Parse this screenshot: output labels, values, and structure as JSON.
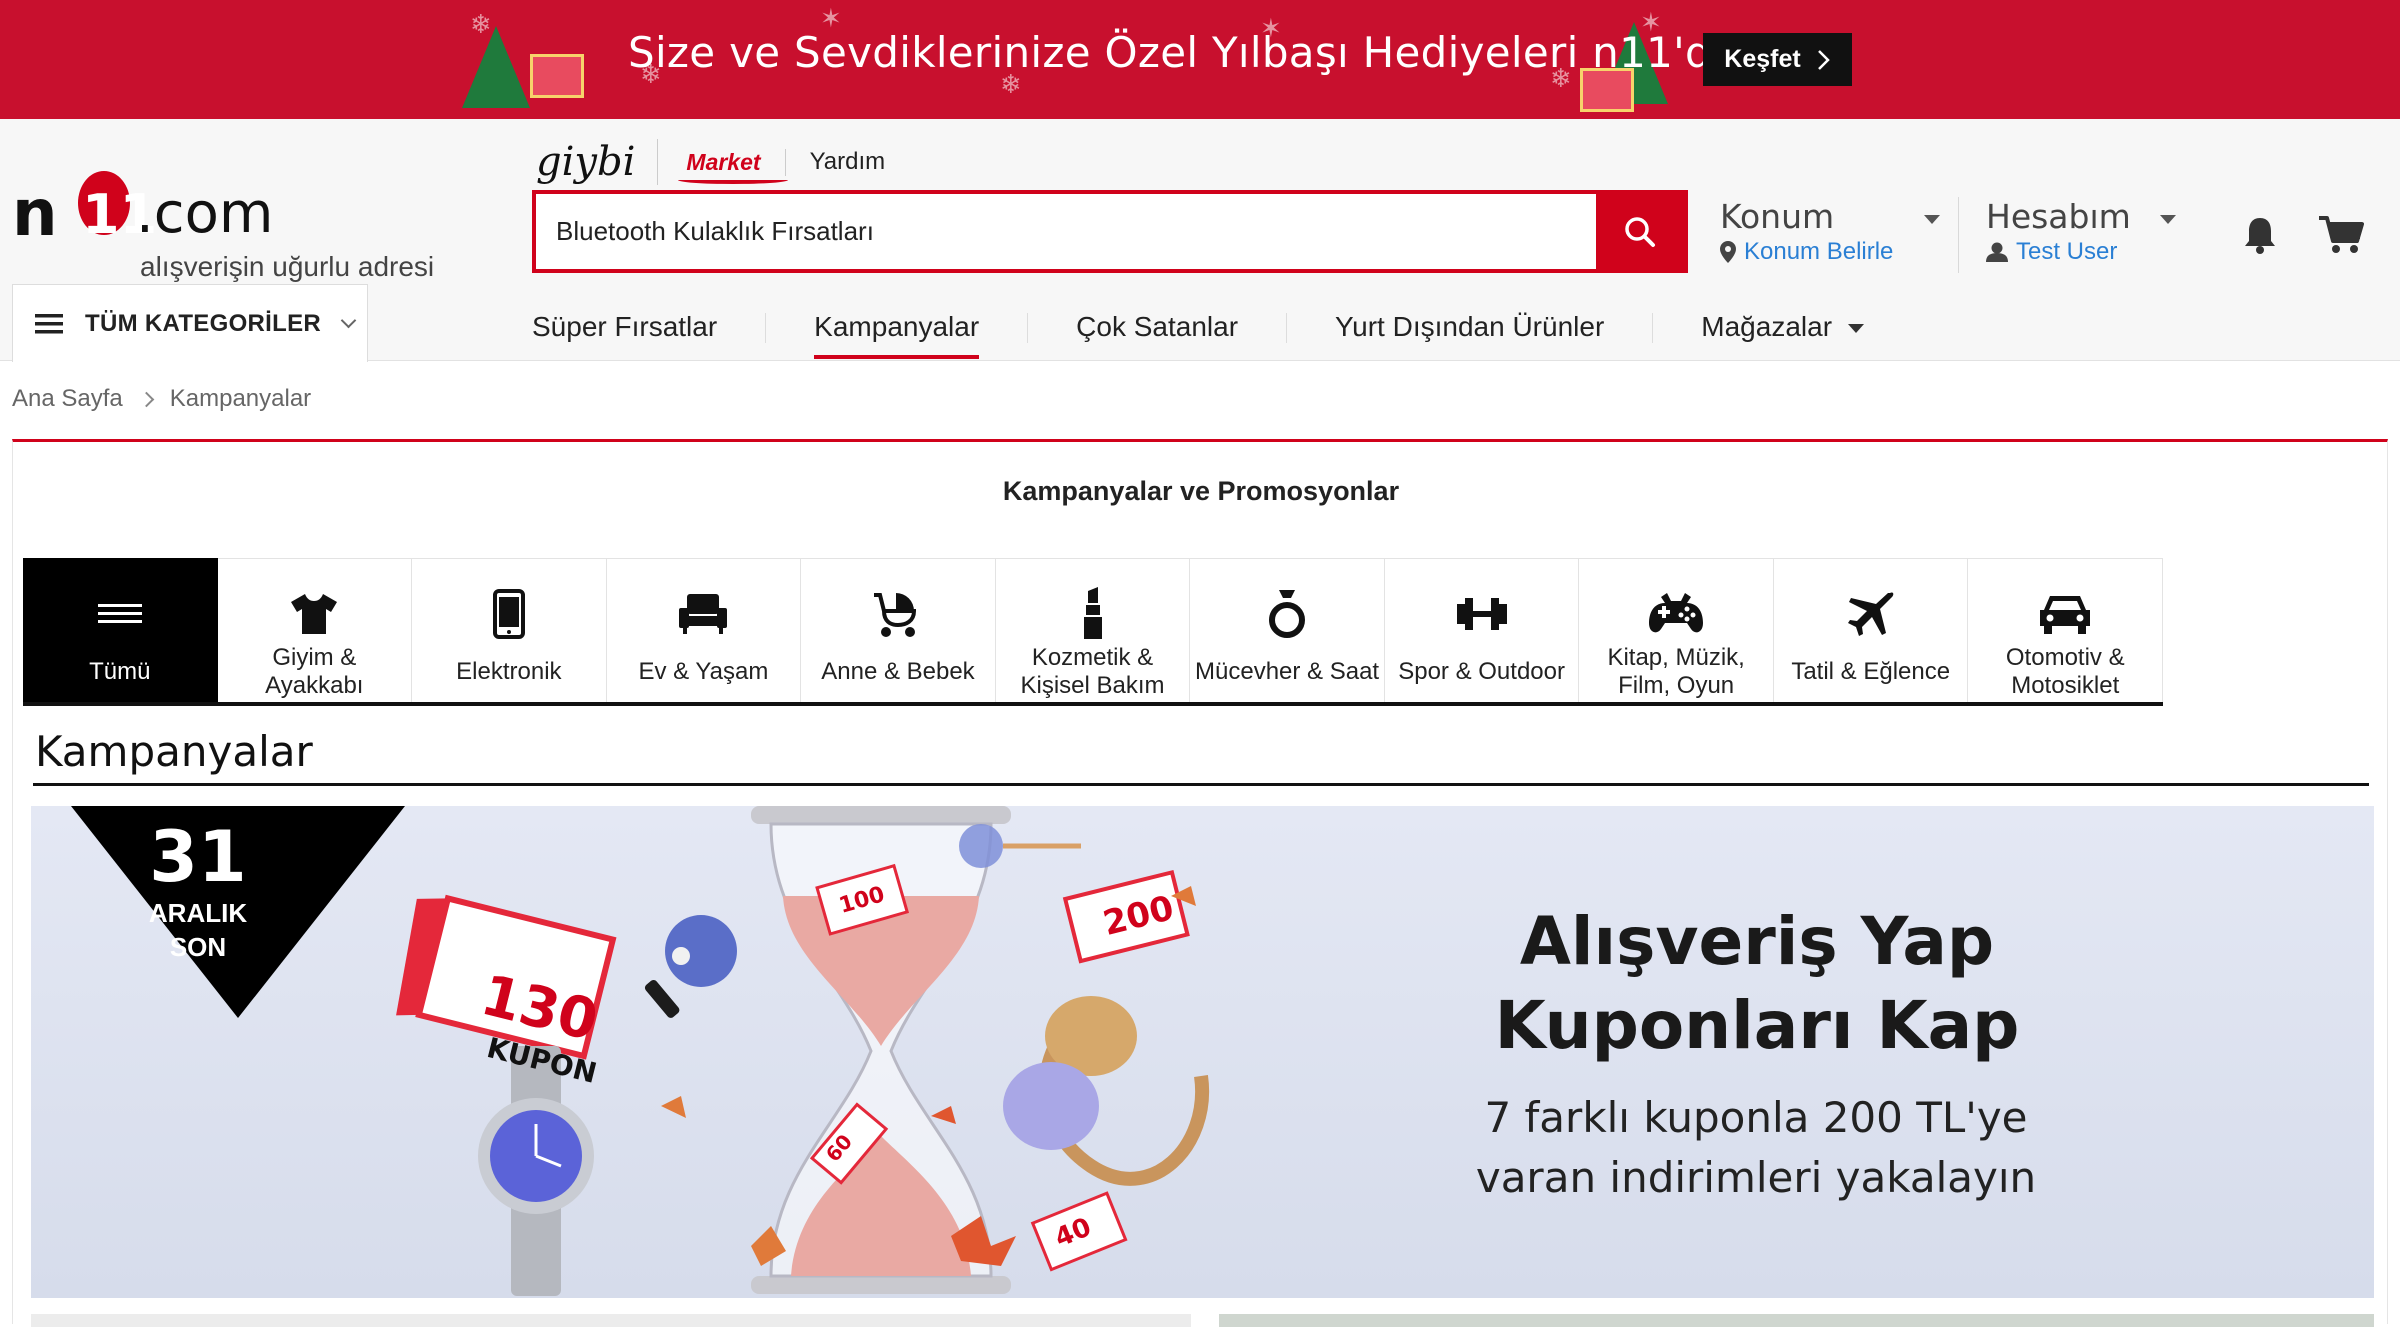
{
  "promo": {
    "text": "Size ve Sevdiklerinize Özel Yılbaşı Hediyeleri n11'de",
    "button": "Keşfet"
  },
  "logo": {
    "n": "n",
    "eleven": "11",
    "dotcom": ".com",
    "slogan": "alışverişin uğurlu adresi"
  },
  "quicklinks": {
    "giybi": "giybi",
    "market": "Market",
    "help": "Yardım"
  },
  "search": {
    "value": "Bluetooth Kulaklık Fırsatları",
    "icon": "search-icon"
  },
  "location": {
    "title": "Konum",
    "action": "Konum Belirle",
    "icon": "map-pin-icon"
  },
  "account": {
    "title": "Hesabım",
    "user": "Test User",
    "icon": "user-icon"
  },
  "all_categories": "TÜM KATEGORİLER",
  "nav": [
    {
      "label": "Süper Fırsatlar"
    },
    {
      "label": "Kampanyalar"
    },
    {
      "label": "Çok Satanlar"
    },
    {
      "label": "Yurt Dışından Ürünler"
    },
    {
      "label": "Mağazalar"
    }
  ],
  "breadcrumb": [
    "Ana Sayfa",
    "Kampanyalar"
  ],
  "content_title": "Kampanyalar ve Promosyonlar",
  "categories": [
    {
      "label": "Tümü",
      "icon": "menu-lines-icon"
    },
    {
      "label": "Giyim & Ayakkabı",
      "icon": "tshirt-icon"
    },
    {
      "label": "Elektronik",
      "icon": "phone-icon"
    },
    {
      "label": "Ev & Yaşam",
      "icon": "armchair-icon"
    },
    {
      "label": "Anne & Bebek",
      "icon": "stroller-icon"
    },
    {
      "label": "Kozmetik & Kişisel Bakım",
      "icon": "lipstick-icon"
    },
    {
      "label": "Mücevher & Saat",
      "icon": "ring-icon"
    },
    {
      "label": "Spor & Outdoor",
      "icon": "dumbbell-icon"
    },
    {
      "label": "Kitap, Müzik, Film, Oyun",
      "icon": "gamepad-icon"
    },
    {
      "label": "Tatil & Eğlence",
      "icon": "airplane-icon"
    },
    {
      "label": "Otomotiv & Motosiklet",
      "icon": "car-icon"
    }
  ],
  "section_title": "Kampanyalar",
  "hero": {
    "badge_day": "31",
    "badge_month": "ARALIK",
    "badge_end": "SON",
    "headline": "Alışveriş Yap Kuponları Kap",
    "subline": "7 farklı kuponla 200 TL'ye varan indirimleri yakalayın",
    "coupons": [
      "130",
      "KUPON",
      "200",
      "100",
      "60",
      "40"
    ]
  },
  "colors": {
    "brand_red": "#d0021b",
    "link_blue": "#2a7fd4",
    "active_black": "#000000"
  }
}
